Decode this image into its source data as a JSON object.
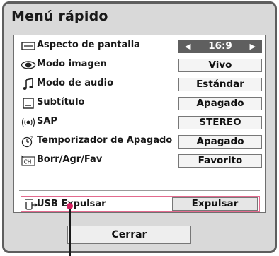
{
  "menu": {
    "title": "Menú rápido",
    "items": [
      {
        "icon": "aspect-ratio-icon",
        "label": "Aspecto de pantalla",
        "value": "16:9",
        "selected": true
      },
      {
        "icon": "eye-icon",
        "label": "Modo imagen",
        "value": "Vivo"
      },
      {
        "icon": "music-note-icon",
        "label": "Modo de audio",
        "value": "Estándar"
      },
      {
        "icon": "subtitle-icon",
        "label": "Subtítulo",
        "value": "Apagado"
      },
      {
        "icon": "sap-icon",
        "label": "SAP",
        "value": "STEREO"
      },
      {
        "icon": "sleep-timer-icon",
        "label": "Temporizador de Apagado",
        "value": "Apagado"
      },
      {
        "icon": "channel-icon",
        "label": "Borr/Agr/Fav",
        "value": "Favorito"
      }
    ],
    "usb": {
      "icon": "usb-eject-icon",
      "label": "USB Expulsar",
      "value": "Expulsar"
    },
    "close_label": "Cerrar"
  },
  "colors": {
    "frame_border": "#5e5e5e",
    "background": "#d9d9d9",
    "selected_value_bg": "#5f5f5f",
    "highlight_border": "#e36a8e",
    "pointer": "#d6205f"
  }
}
